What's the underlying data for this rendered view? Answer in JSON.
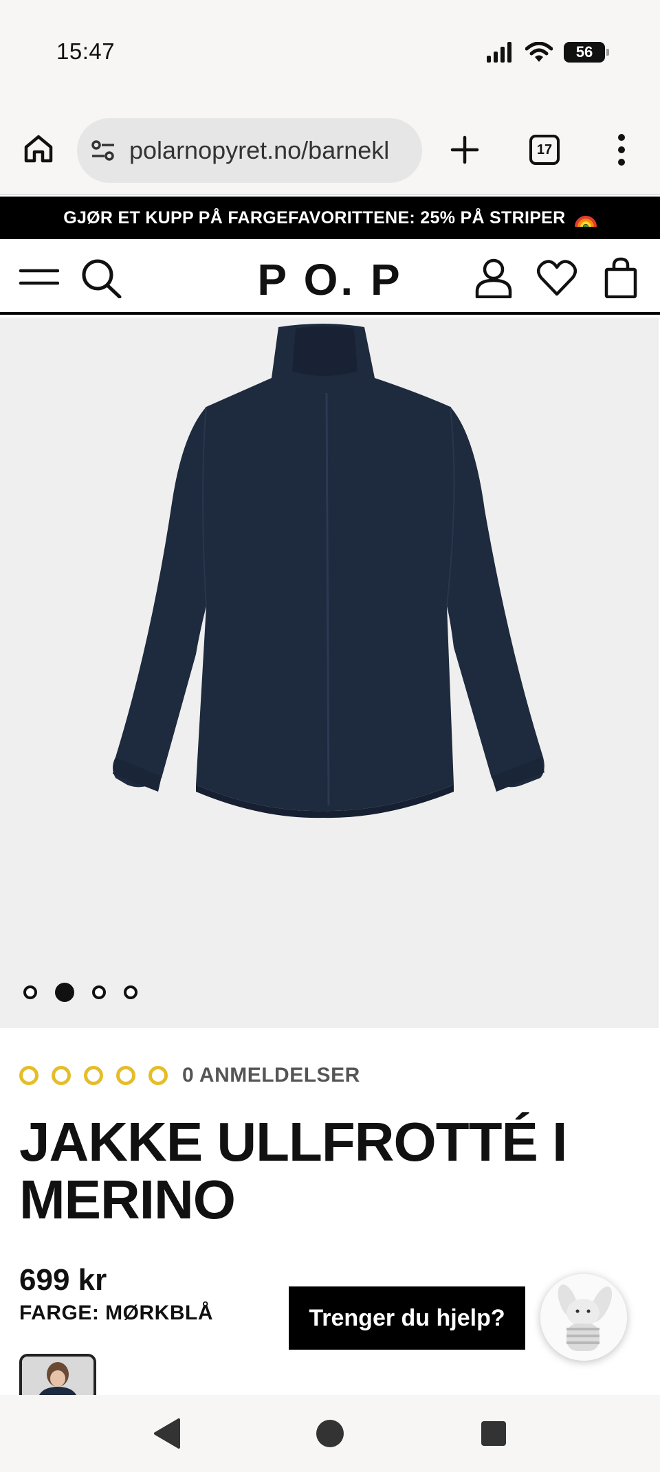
{
  "status_bar": {
    "time": "15:47",
    "battery": "56"
  },
  "browser": {
    "url": "polarnopyret.no/barnekl",
    "tab_count": "17"
  },
  "promo": {
    "text": "GJØR ET KUPP PÅ FARGEFAVORITTENE: 25% PÅ STRIPER"
  },
  "header": {
    "logo": "P O. P"
  },
  "gallery": {
    "slide_count": 4,
    "active_slide": 2,
    "jacket_color": "#1e2a3d",
    "background_color": "#efefef"
  },
  "product": {
    "rating_stars": 0,
    "reviews_label": "0 ANMELDELSER",
    "title": "JAKKE ULLFROTTÉ I MERINO",
    "price": "699 kr",
    "color_label": "FARGE: MØRKBLÅ"
  },
  "help": {
    "label": "Trenger du hjelp?"
  },
  "colors": {
    "star_outline": "#e5bd27",
    "banner_bg": "#000000",
    "brand_text": "#111111"
  }
}
